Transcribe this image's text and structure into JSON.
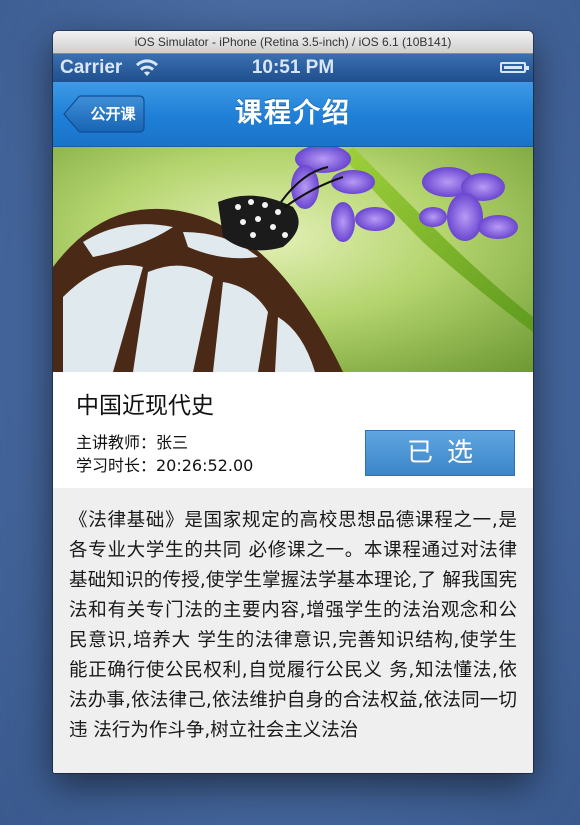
{
  "window": {
    "title": "iOS Simulator - iPhone (Retina 3.5-inch) / iOS 6.1 (10B141)"
  },
  "status_bar": {
    "carrier": "Carrier",
    "time": "10:51 PM"
  },
  "nav": {
    "back_label": "公开课",
    "title": "课程介绍"
  },
  "course": {
    "name": "中国近现代史",
    "teacher": "主讲教师：张三",
    "duration": "学习时长：20:26:52.00",
    "select_label": "已选"
  },
  "description": "《法律基础》是国家规定的高校思想品德课程之一,是各专业大学生的共同 必修课之一。本课程通过对法律基础知识的传授,使学生掌握法学基本理论,了 解我国宪法和有关专门法的主要内容,增强学生的法治观念和公民意识,培养大 学生的法律意识,完善知识结构,使学生能正确行使公民权利,自觉履行公民义 务,知法懂法,依法办事,依法律己,依法维护自身的合法权益,依法同一切违 法行为作斗争,树立社会主义法治",
  "colors": {
    "nav_blue": "#1f7fd6",
    "button_blue": "#4a90d2",
    "desc_bg": "#efefef"
  },
  "icons": {
    "wifi": "wifi-icon",
    "battery": "battery-icon",
    "back": "back-arrow-icon"
  }
}
